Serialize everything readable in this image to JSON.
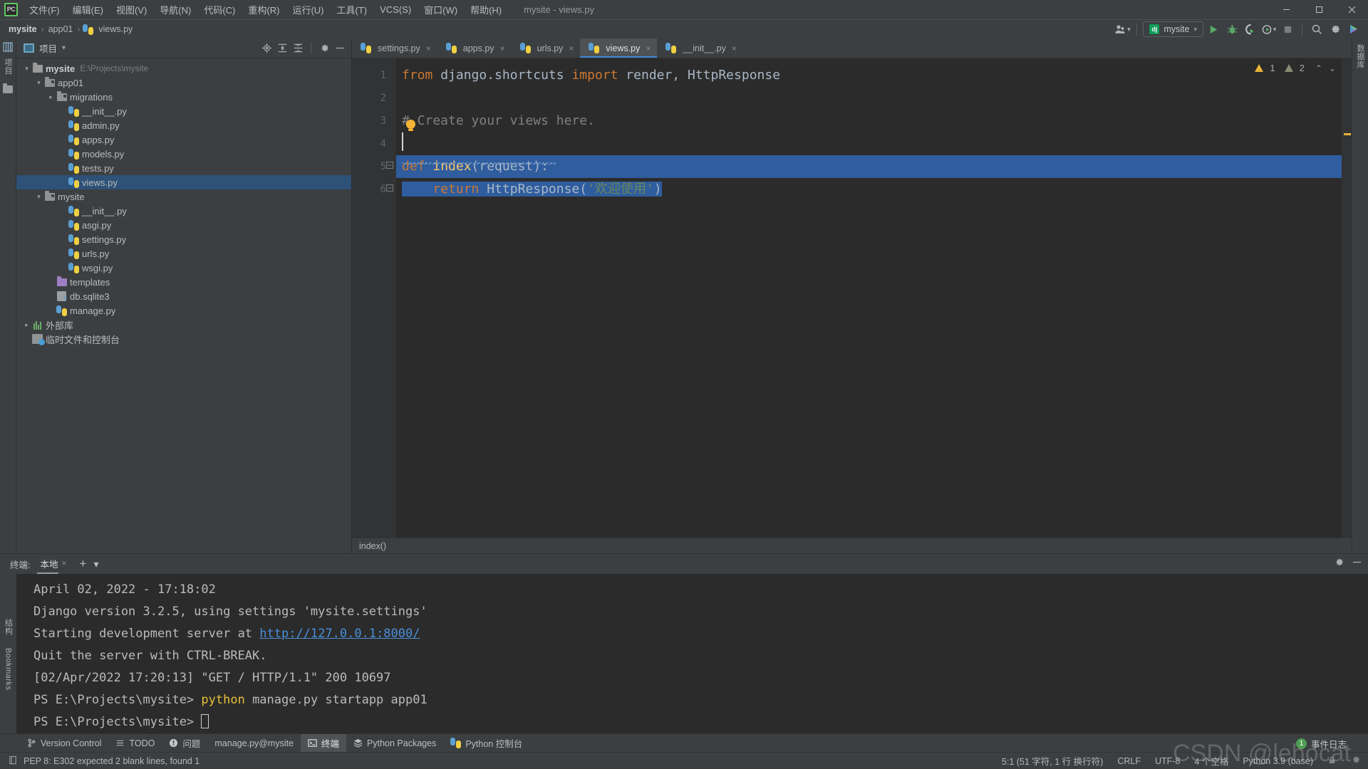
{
  "window": {
    "title": "mysite - views.py",
    "logo": "PC",
    "controls": [
      "minimize",
      "maximize",
      "close"
    ]
  },
  "menu": {
    "items": [
      {
        "label": "文件(F)",
        "name": "menu-file"
      },
      {
        "label": "编辑(E)",
        "name": "menu-edit"
      },
      {
        "label": "视图(V)",
        "name": "menu-view"
      },
      {
        "label": "导航(N)",
        "name": "menu-navigate"
      },
      {
        "label": "代码(C)",
        "name": "menu-code"
      },
      {
        "label": "重构(R)",
        "name": "menu-refactor"
      },
      {
        "label": "运行(U)",
        "name": "menu-run"
      },
      {
        "label": "工具(T)",
        "name": "menu-tools"
      },
      {
        "label": "VCS(S)",
        "name": "menu-vcs"
      },
      {
        "label": "窗口(W)",
        "name": "menu-window"
      },
      {
        "label": "帮助(H)",
        "name": "menu-help"
      }
    ]
  },
  "breadcrumb": {
    "items": [
      "mysite",
      "app01",
      "views.py"
    ],
    "separator": "›"
  },
  "toolbar": {
    "run_config": {
      "label": "mysite",
      "badge": "dj"
    },
    "icons": [
      "user-avatar-icon",
      "run-icon",
      "debug-icon",
      "run-coverage-icon",
      "profile-icon",
      "stop-icon",
      "search-everywhere-icon",
      "settings-icon",
      "updates-icon"
    ]
  },
  "project_pane": {
    "title": "项目",
    "actions": [
      "locate-icon",
      "expand-all-icon",
      "collapse-all-icon",
      "settings-icon",
      "hide-icon"
    ],
    "tree": [
      {
        "label": "mysite",
        "path": "E:\\Projects\\mysite",
        "icon": "folder-root",
        "depth": 0,
        "arrow": "down",
        "bold": true,
        "selected": false
      },
      {
        "label": "app01",
        "path": "",
        "icon": "folder-module",
        "depth": 1,
        "arrow": "down",
        "bold": false,
        "selected": false
      },
      {
        "label": "migrations",
        "path": "",
        "icon": "folder-module",
        "depth": 2,
        "arrow": "right",
        "bold": false,
        "selected": false
      },
      {
        "label": "__init__.py",
        "path": "",
        "icon": "python-file",
        "depth": 3,
        "arrow": "",
        "bold": false,
        "selected": false
      },
      {
        "label": "admin.py",
        "path": "",
        "icon": "python-file",
        "depth": 3,
        "arrow": "",
        "bold": false,
        "selected": false
      },
      {
        "label": "apps.py",
        "path": "",
        "icon": "python-file",
        "depth": 3,
        "arrow": "",
        "bold": false,
        "selected": false
      },
      {
        "label": "models.py",
        "path": "",
        "icon": "python-file",
        "depth": 3,
        "arrow": "",
        "bold": false,
        "selected": false
      },
      {
        "label": "tests.py",
        "path": "",
        "icon": "python-file",
        "depth": 3,
        "arrow": "",
        "bold": false,
        "selected": false
      },
      {
        "label": "views.py",
        "path": "",
        "icon": "python-file",
        "depth": 3,
        "arrow": "",
        "bold": false,
        "selected": true
      },
      {
        "label": "mysite",
        "path": "",
        "icon": "folder-module",
        "depth": 1,
        "arrow": "down",
        "bold": false,
        "selected": false
      },
      {
        "label": "__init__.py",
        "path": "",
        "icon": "python-file",
        "depth": 3,
        "arrow": "",
        "bold": false,
        "selected": false
      },
      {
        "label": "asgi.py",
        "path": "",
        "icon": "python-file",
        "depth": 3,
        "arrow": "",
        "bold": false,
        "selected": false
      },
      {
        "label": "settings.py",
        "path": "",
        "icon": "python-file",
        "depth": 3,
        "arrow": "",
        "bold": false,
        "selected": false
      },
      {
        "label": "urls.py",
        "path": "",
        "icon": "python-file",
        "depth": 3,
        "arrow": "",
        "bold": false,
        "selected": false
      },
      {
        "label": "wsgi.py",
        "path": "",
        "icon": "python-file",
        "depth": 3,
        "arrow": "",
        "bold": false,
        "selected": false
      },
      {
        "label": "templates",
        "path": "",
        "icon": "folder-templates",
        "depth": 2,
        "arrow": "",
        "bold": false,
        "selected": false
      },
      {
        "label": "db.sqlite3",
        "path": "",
        "icon": "db-file",
        "depth": 2,
        "arrow": "",
        "bold": false,
        "selected": false
      },
      {
        "label": "manage.py",
        "path": "",
        "icon": "python-file",
        "depth": 2,
        "arrow": "",
        "bold": false,
        "selected": false
      },
      {
        "label": "外部库",
        "path": "",
        "icon": "library-icon",
        "depth": 0,
        "arrow": "right",
        "bold": false,
        "selected": false
      },
      {
        "label": "临时文件和控制台",
        "path": "",
        "icon": "scratches-icon",
        "depth": 0,
        "arrow": "",
        "bold": false,
        "selected": false
      }
    ]
  },
  "editor": {
    "tabs": [
      {
        "label": "settings.py",
        "active": false
      },
      {
        "label": "apps.py",
        "active": false
      },
      {
        "label": "urls.py",
        "active": false
      },
      {
        "label": "views.py",
        "active": true
      },
      {
        "label": "__init__.py",
        "active": false
      }
    ],
    "close_glyph": "×",
    "line_numbers": [
      "1",
      "2",
      "3",
      "4",
      "5",
      "6"
    ],
    "lines": [
      {
        "n": 1,
        "tokens": [
          {
            "t": "from",
            "c": "kw"
          },
          {
            "t": " django.shortcuts ",
            "c": "plain"
          },
          {
            "t": "import",
            "c": "kw"
          },
          {
            "t": " render, HttpResponse",
            "c": "plain"
          }
        ]
      },
      {
        "n": 2,
        "tokens": []
      },
      {
        "n": 3,
        "tokens": [
          {
            "t": "# Create your views here.",
            "c": "cmt"
          }
        ]
      },
      {
        "n": 4,
        "tokens": []
      },
      {
        "n": 5,
        "tokens": [
          {
            "t": "def",
            "c": "kw"
          },
          {
            "t": " ",
            "c": "plain"
          },
          {
            "t": "index",
            "c": "fn"
          },
          {
            "t": "(request):",
            "c": "plain"
          }
        ]
      },
      {
        "n": 6,
        "tokens": [
          {
            "t": "    ",
            "c": "plain"
          },
          {
            "t": "return",
            "c": "kw"
          },
          {
            "t": " HttpResponse(",
            "c": "plain"
          },
          {
            "t": "'欢迎使用'",
            "c": "str"
          },
          {
            "t": ")",
            "c": "plain"
          }
        ]
      }
    ],
    "inspection": {
      "warnings": "1",
      "weak_warnings": "2"
    },
    "bottom_breadcrumb": "index()",
    "gutter_marks": [
      "",
      "",
      "",
      "",
      "−",
      "−"
    ]
  },
  "terminal": {
    "label": "终端:",
    "tab": "本地",
    "add_glyph": "+",
    "dropdown_glyph": "⌄",
    "lines": [
      [
        {
          "t": "April 02, 2022 - 17:18:02",
          "c": "plain"
        }
      ],
      [
        {
          "t": "Django version 3.2.5, using settings 'mysite.settings'",
          "c": "plain"
        }
      ],
      [
        {
          "t": "Starting development server at ",
          "c": "plain"
        },
        {
          "t": "http://127.0.0.1:8000/",
          "c": "link"
        }
      ],
      [
        {
          "t": "Quit the server with CTRL-BREAK.",
          "c": "plain"
        }
      ],
      [
        {
          "t": "[02/Apr/2022 17:20:13] \"GET / HTTP/1.1\" 200 10697",
          "c": "plain"
        }
      ],
      [
        {
          "t": "PS E:\\Projects\\mysite> ",
          "c": "plain"
        },
        {
          "t": "python",
          "c": "yellow"
        },
        {
          "t": " manage.py startapp app01",
          "c": "plain"
        }
      ],
      [
        {
          "t": "PS E:\\Projects\\mysite> ",
          "c": "plain"
        },
        {
          "t": "",
          "c": "cursor"
        }
      ]
    ],
    "actions": [
      "settings-icon",
      "hide-icon"
    ]
  },
  "tool_window_bar": {
    "items": [
      {
        "label": "Version Control",
        "icon": "branch-icon",
        "active": false
      },
      {
        "label": "TODO",
        "icon": "list-icon",
        "active": false
      },
      {
        "label": "问题",
        "icon": "error-icon",
        "active": false
      },
      {
        "label": "manage.py@mysite",
        "icon": "",
        "active": false
      },
      {
        "label": "终端",
        "icon": "terminal-icon",
        "active": true
      },
      {
        "label": "Python Packages",
        "icon": "packages-icon",
        "active": false
      },
      {
        "label": "Python 控制台",
        "icon": "python-icon",
        "active": false
      }
    ]
  },
  "left_strip": {
    "labels": [
      "项目"
    ],
    "icons": [
      "project-icon",
      "commit-icon"
    ]
  },
  "right_strip": {
    "labels": [
      "数据库"
    ]
  },
  "bottom_left_strip": {
    "labels": [
      "结构",
      "Bookmarks"
    ]
  },
  "status_bar": {
    "inspection_message": "PEP 8: E302 expected 2 blank lines, found 1",
    "caret": "5:1 (51 字符, 1 行 换行符)",
    "line_separator": "CRLF",
    "encoding": "UTF-8",
    "indent": "4 个空格",
    "interpreter": "Python 3.9 (base)",
    "event_log": "事件日志",
    "event_count": "1"
  },
  "watermark": "CSDN @lehocat",
  "colors": {
    "accent": "#3d8bd4",
    "selection": "#2f5d9e",
    "keyword": "#cc7832",
    "function": "#ffc66d",
    "string": "#6a8759",
    "comment": "#808080",
    "editor_bg": "#2b2b2b",
    "chrome_bg": "#3c3f41",
    "link": "#4a8fd8"
  }
}
